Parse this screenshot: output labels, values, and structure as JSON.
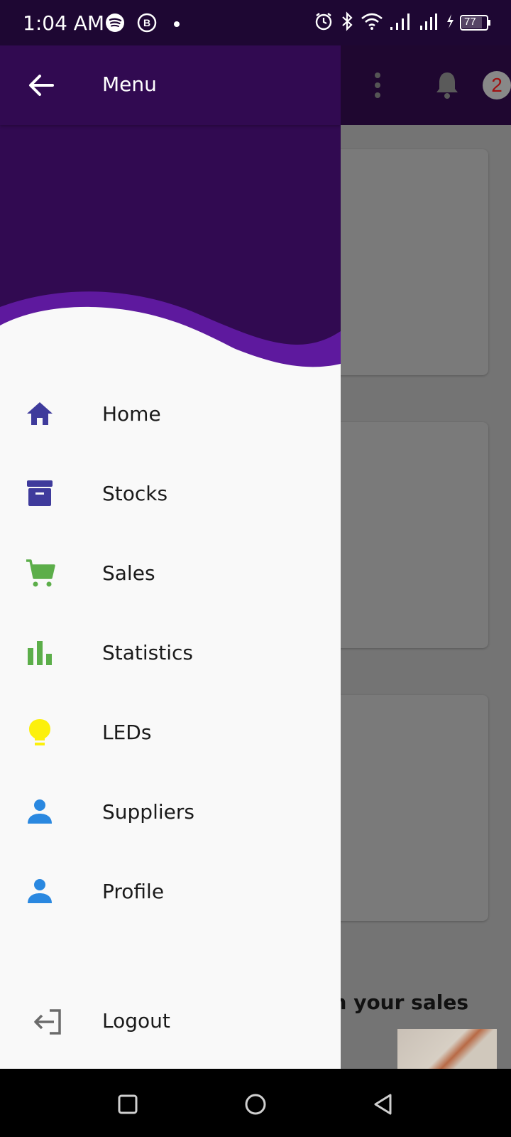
{
  "status_bar": {
    "time": "1:04 AM",
    "battery": "77",
    "icons": [
      "spotify-icon",
      "b-app-icon",
      "dot-icon",
      "alarm-icon",
      "bluetooth-icon",
      "wifi-icon",
      "signal-icon",
      "signal-icon",
      "charging-icon",
      "battery-icon"
    ]
  },
  "drawer": {
    "title": "Menu",
    "colors": {
      "header": "#310a51",
      "wave_accent": "#5e199e",
      "indigo": "#3f3b9c",
      "green": "#5cae4a",
      "yellow": "#fcf00c",
      "blue": "#2a88e0"
    },
    "items": [
      {
        "label": "Home",
        "icon": "home-icon"
      },
      {
        "label": "Stocks",
        "icon": "archive-box-icon"
      },
      {
        "label": "Sales",
        "icon": "shopping-cart-icon"
      },
      {
        "label": "Statistics",
        "icon": "bar-chart-icon"
      },
      {
        "label": "LEDs",
        "icon": "lightbulb-icon"
      },
      {
        "label": "Suppliers",
        "icon": "person-icon"
      },
      {
        "label": "Profile",
        "icon": "person-icon"
      }
    ],
    "logout": {
      "label": "Logout",
      "icon": "logout-icon"
    }
  },
  "background_app": {
    "notification_count": "2",
    "partial_text": "n your sales"
  },
  "nav_bar": {
    "buttons": [
      "recents-button",
      "home-button",
      "back-button"
    ]
  }
}
